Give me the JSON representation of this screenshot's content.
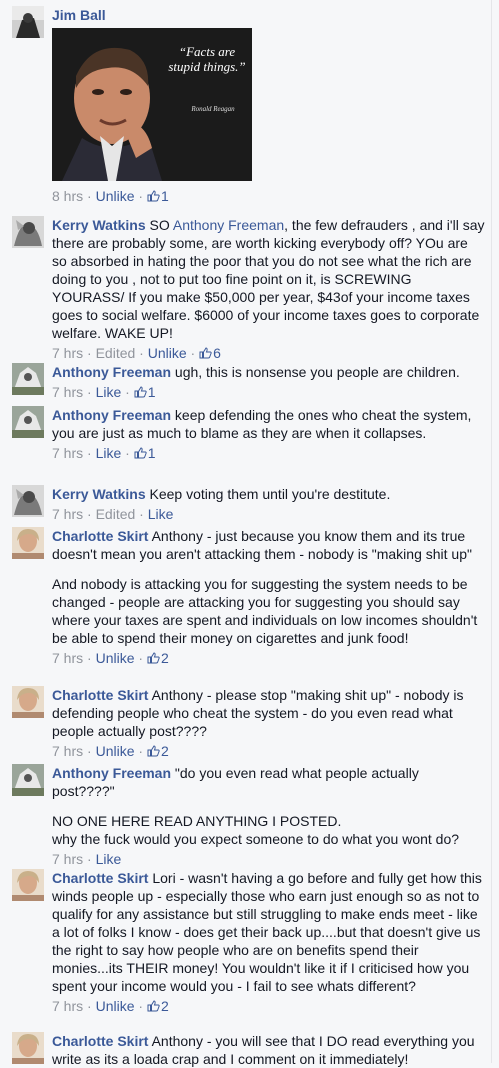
{
  "comments": [
    {
      "author": "Jim Ball",
      "image": {
        "quote": "“Facts are stupid things.”",
        "attribution": "Ronald Reagan"
      },
      "time": "8 hrs",
      "action": "Unlike",
      "likes": "1"
    },
    {
      "author": "Kerry Watkins",
      "text_pre": " SO ",
      "mention": "Anthony Freeman",
      "text_post": ", the few defrauders , and i'll say there are probably some, are worth kicking everybody off? YOu are so absorbed in hating the poor that you do not see what the rich are doing to you , not to put too fine point on it, is SCREWING YOURASS/ If you make $50,000 per year, $43of your income taxes goes to social welfare. $6000 of your income taxes goes to corporate welfare. WAKE UP!",
      "time": "7 hrs",
      "edited": "Edited",
      "action": "Unlike",
      "likes": "6"
    },
    {
      "author": "Anthony Freeman",
      "text": " ugh, this is nonsense you people are children.",
      "time": "7 hrs",
      "action": "Like",
      "likes": "1"
    },
    {
      "author": "Anthony Freeman",
      "text": " keep defending the ones who cheat the system, you are just as much to blame as they are when it collapses.",
      "time": "7 hrs",
      "action": "Like",
      "likes": "1"
    },
    {
      "author": "Kerry Watkins",
      "text": " Keep voting them until you're destitute.",
      "time": "7 hrs",
      "edited": "Edited",
      "action": "Like"
    },
    {
      "author": "Charlotte Skirt",
      "text": " Anthony - just because you know them and its true doesn't mean you aren't attacking them - nobody is \"making shit up\"",
      "para2": "And nobody is attacking you for suggesting the system needs to be changed - people are attacking you for suggesting you should say where your taxes are spent and individuals on low incomes shouldn't be able to spend their money on cigarettes and junk food!",
      "time": "7 hrs",
      "action": "Unlike",
      "likes": "2"
    },
    {
      "author": "Charlotte Skirt",
      "text": " Anthony - please stop \"making shit up\" - nobody is defending people who cheat the system - do you even read what people actually post????",
      "time": "7 hrs",
      "action": "Unlike",
      "likes": "2"
    },
    {
      "author": "Anthony Freeman",
      "text": " \"do you even read what people actually post????\"",
      "para2": "NO ONE HERE READ ANYTHING I POSTED.",
      "para3": "why the fuck would you expect someone to do what you wont do?",
      "time": "7 hrs",
      "action": "Like"
    },
    {
      "author": "Charlotte Skirt",
      "text": " Lori - wasn't having a go before and fully get how this winds people up - especially those who earn just enough so as not to qualify for any assistance but still struggling to make ends meet - like a lot of folks I know - does get their back up....but that doesn't give us the right to say how people who are on benefits spend their monies...its THEIR money! You wouldn't like it if I criticised how you spent your income would you - I fail to see whats different?",
      "time": "7 hrs",
      "action": "Unlike",
      "likes": "2"
    },
    {
      "author": "Charlotte Skirt",
      "text": " Anthony - you will see that I DO read everything you write as its a loada crap and I comment on it immediately!"
    }
  ],
  "sep": " · ",
  "colors": {
    "link": "#3b5998",
    "meta": "#90949c",
    "bg": "#f6f7f9"
  },
  "icons": {
    "like": "thumbs-up-icon"
  }
}
